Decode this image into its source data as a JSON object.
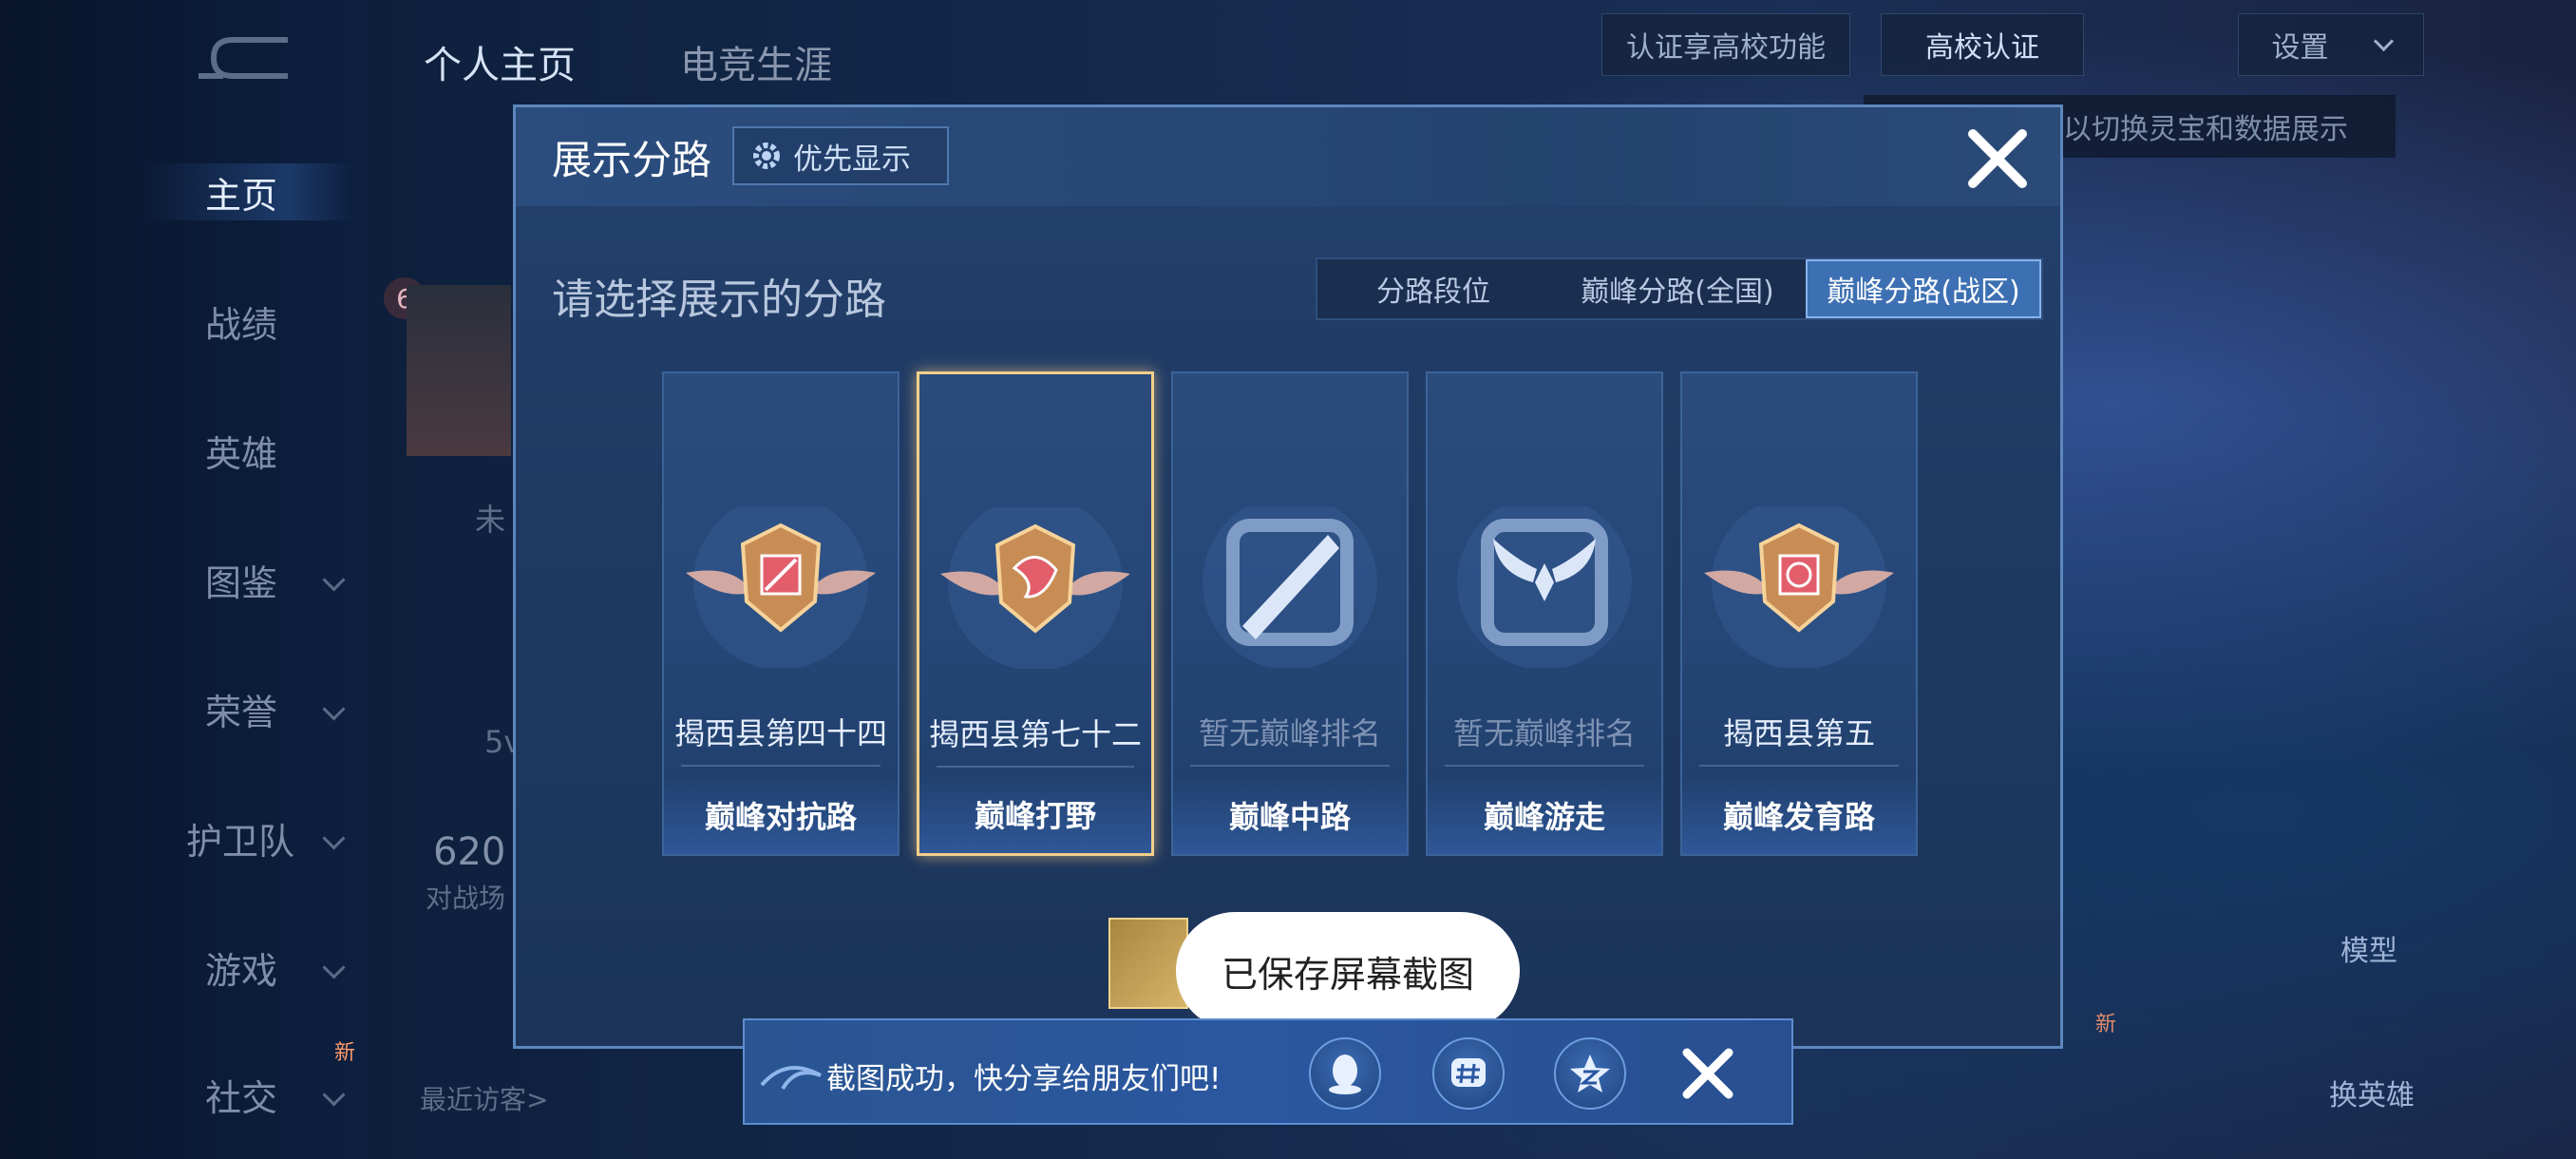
{
  "nav": {
    "top_tabs": [
      "个人主页",
      "电竞生涯"
    ],
    "side_items": [
      {
        "label": "主页",
        "active": true
      },
      {
        "label": "战绩"
      },
      {
        "label": "英雄"
      },
      {
        "label": "图鉴"
      },
      {
        "label": "荣誉"
      },
      {
        "label": "护卫队"
      },
      {
        "label": "游戏"
      },
      {
        "label": "社交"
      }
    ],
    "new_badge": "新"
  },
  "top_right": {
    "cert_feature": "认证享高校功能",
    "campus_cert": "高校认证",
    "settings": "设置",
    "hint": "以切换灵宝和数据展示"
  },
  "background": {
    "level_badge": "6",
    "unconfigured": "未",
    "count_5v": "5v",
    "score": "620",
    "score_sub": "对战场",
    "recent_visitors": "最近访客>",
    "model_label": "模型",
    "change_hero_label": "换英雄",
    "right_new": "新"
  },
  "dialog": {
    "title": "展示分路",
    "priority_button": "优先显示",
    "subtitle": "请选择展示的分路",
    "segments": [
      "分路段位",
      "巅峰分路(全国)",
      "巅峰分路(战区)"
    ],
    "active_segment": 2,
    "cards": [
      {
        "rank": "揭西县第四十四",
        "position": "巅峰对抗路",
        "ranked": true,
        "selected": false,
        "icon": "sword-crest-icon"
      },
      {
        "rank": "揭西县第七十二",
        "position": "巅峰打野",
        "ranked": true,
        "selected": true,
        "icon": "jungle-crest-icon"
      },
      {
        "rank": "暂无巅峰排名",
        "position": "巅峰中路",
        "ranked": false,
        "selected": false,
        "icon": "mid-lane-icon"
      },
      {
        "rank": "暂无巅峰排名",
        "position": "巅峰游走",
        "ranked": false,
        "selected": false,
        "icon": "support-wings-icon"
      },
      {
        "rank": "揭西县第五",
        "position": "巅峰发育路",
        "ranked": true,
        "selected": false,
        "icon": "marksman-crest-icon"
      }
    ]
  },
  "toast": {
    "text": "已保存屏幕截图"
  },
  "share_bar": {
    "text": "截图成功，快分享给朋友们吧!",
    "icons": [
      "qq-icon",
      "hashtag-icon",
      "qzone-star-icon",
      "close-icon"
    ]
  },
  "colors": {
    "selected_border": "#f3cf8a",
    "dialog_bg": "#24416d",
    "segment_active": "#3d70b3",
    "share_bar": "#2a57a0"
  }
}
